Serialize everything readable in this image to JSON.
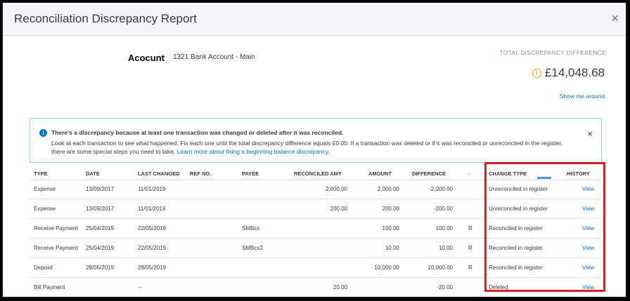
{
  "dialog": {
    "title": "Reconciliation Discrepancy Report",
    "close_icon": "×"
  },
  "account": {
    "label": "Acocunt",
    "value": "1321 Bank Account - Main"
  },
  "summary": {
    "label": "TOTAL DISCREPANCY DIFFERENCE",
    "amount": "£14,048.68",
    "link": "Show me around",
    "warning_icon": "!"
  },
  "banner": {
    "info_icon": "i",
    "title": "There's a discrepancy because at least one transaction was changed or deleted after it was reconciled.",
    "body_line1": "Look at each transaction to see what happened. Fix each one until the total discrepancy difference equals £0.00. If a transaction was deleted or if it was reconciled or unreconciled in the",
    "body_line2": "register, there are some special steps you need to take.",
    "link": "Learn more about fixing a beginning balance discrepancy",
    "link_suffix": ".",
    "close_icon": "×"
  },
  "table": {
    "headers": {
      "type": "TYPE",
      "date": "DATE",
      "last_changed": "LAST CHANGED",
      "ref_no": "REF NO.",
      "payee": "PAYEE",
      "reconciled_amt": "RECONCILED AMT",
      "amount": "AMOUNT",
      "difference": "DIFFERENCE",
      "check": "✓",
      "change_type": "CHANGE TYPE",
      "history": "HISTORY"
    },
    "rows": [
      {
        "type": "Expense",
        "date": "13/09/2017",
        "last_changed": "11/01/2019",
        "ref_no": "",
        "payee": "",
        "reconciled_amt": "2,000.00",
        "amount": "2,000.00",
        "difference": "-2,000.00",
        "status": "",
        "change_type": "Unreconciled in register",
        "history": "View"
      },
      {
        "type": "Expense",
        "date": "13/09/2017",
        "last_changed": "11/01/2019",
        "ref_no": "",
        "payee": "",
        "reconciled_amt": "200.00",
        "amount": "200.00",
        "difference": "-200.00",
        "status": "",
        "change_type": "Unreconciled in register",
        "history": "View"
      },
      {
        "type": "Receive Payment",
        "date": "25/04/2019",
        "last_changed": "22/05/2019",
        "ref_no": "",
        "payee": "SMBcx",
        "reconciled_amt": "",
        "amount": "100.00",
        "difference": "100.00",
        "status": "R",
        "change_type": "Reconciled in register",
        "history": "View"
      },
      {
        "type": "Receive Payment",
        "date": "25/04/2019",
        "last_changed": "22/05/2019",
        "ref_no": "",
        "payee": "SMBcx2",
        "reconciled_amt": "",
        "amount": "10.00",
        "difference": "10.00",
        "status": "R",
        "change_type": "Reconciled in register",
        "history": "View"
      },
      {
        "type": "Deposit",
        "date": "28/05/2019",
        "last_changed": "28/05/2019",
        "ref_no": "",
        "payee": "",
        "reconciled_amt": "",
        "amount": "10,000.00",
        "difference": "10,000.00",
        "status": "R",
        "change_type": "Reconciled in register",
        "history": "View"
      },
      {
        "type": "Bill Payment",
        "date": "",
        "last_changed": "--",
        "ref_no": "",
        "payee": "",
        "reconciled_amt": "20.00",
        "amount": "",
        "difference": "-20.00",
        "status": "",
        "change_type": "Deleted",
        "history": "View"
      }
    ]
  },
  "colors": {
    "link": "#0077c5",
    "highlight_box": "#e02020",
    "warning": "#f2a51a",
    "banner_border": "#8ecfe9"
  }
}
